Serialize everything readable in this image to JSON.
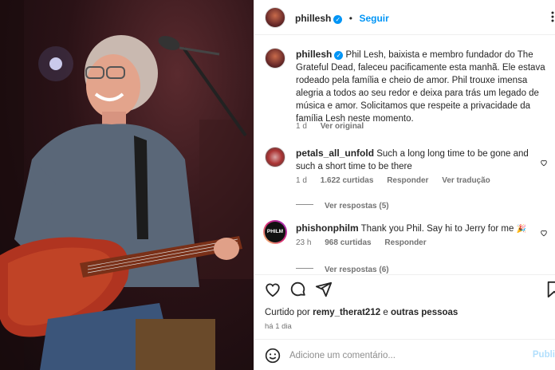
{
  "post": {
    "username": "phillesh",
    "follow_label": "Seguir",
    "caption": "Phil Lesh, baixista e membro fundador do The Grateful Dead, faleceu pacificamente esta manhã. Ele estava rodeado pela família e cheio de amor. Phil trouxe imensa alegria a todos ao seu redor e deixa para trás um legado de música e amor. Solicitamos que respeite a privacidade da família Lesh neste momento.",
    "caption_age": "1 d",
    "see_original": "Ver original"
  },
  "comments": [
    {
      "username": "petals_all_unfold",
      "text": "Such a long long time to be gone and such a short time to be there",
      "age": "1 d",
      "likes": "1.622 curtidas",
      "reply": "Responder",
      "translate": "Ver tradução",
      "view_replies": "Ver respostas (5)"
    },
    {
      "username": "phishonphilm",
      "avatar_label": "PHILM",
      "text": "Thank you Phil. Say hi to Jerry for me",
      "age": "23 h",
      "likes": "968 curtidas",
      "reply": "Responder",
      "view_replies": "Ver respostas (6)"
    }
  ],
  "likes_line": {
    "prefix": "Curtido por",
    "user": "remy_therat212",
    "middle": "e",
    "others": "outras pessoas"
  },
  "post_age": "há 1 dia",
  "comment_bar": {
    "placeholder": "Adicione um comentário...",
    "publish": "Publi"
  },
  "icons": [
    "heart-icon",
    "comment-icon",
    "share-icon",
    "bookmark-icon",
    "emoji-icon",
    "verified-icon",
    "more-icon",
    "party-icon"
  ],
  "colors": {
    "accent": "#0095f6",
    "text": "#262626",
    "muted": "#737373",
    "publish_disabled": "#b2dffc"
  }
}
